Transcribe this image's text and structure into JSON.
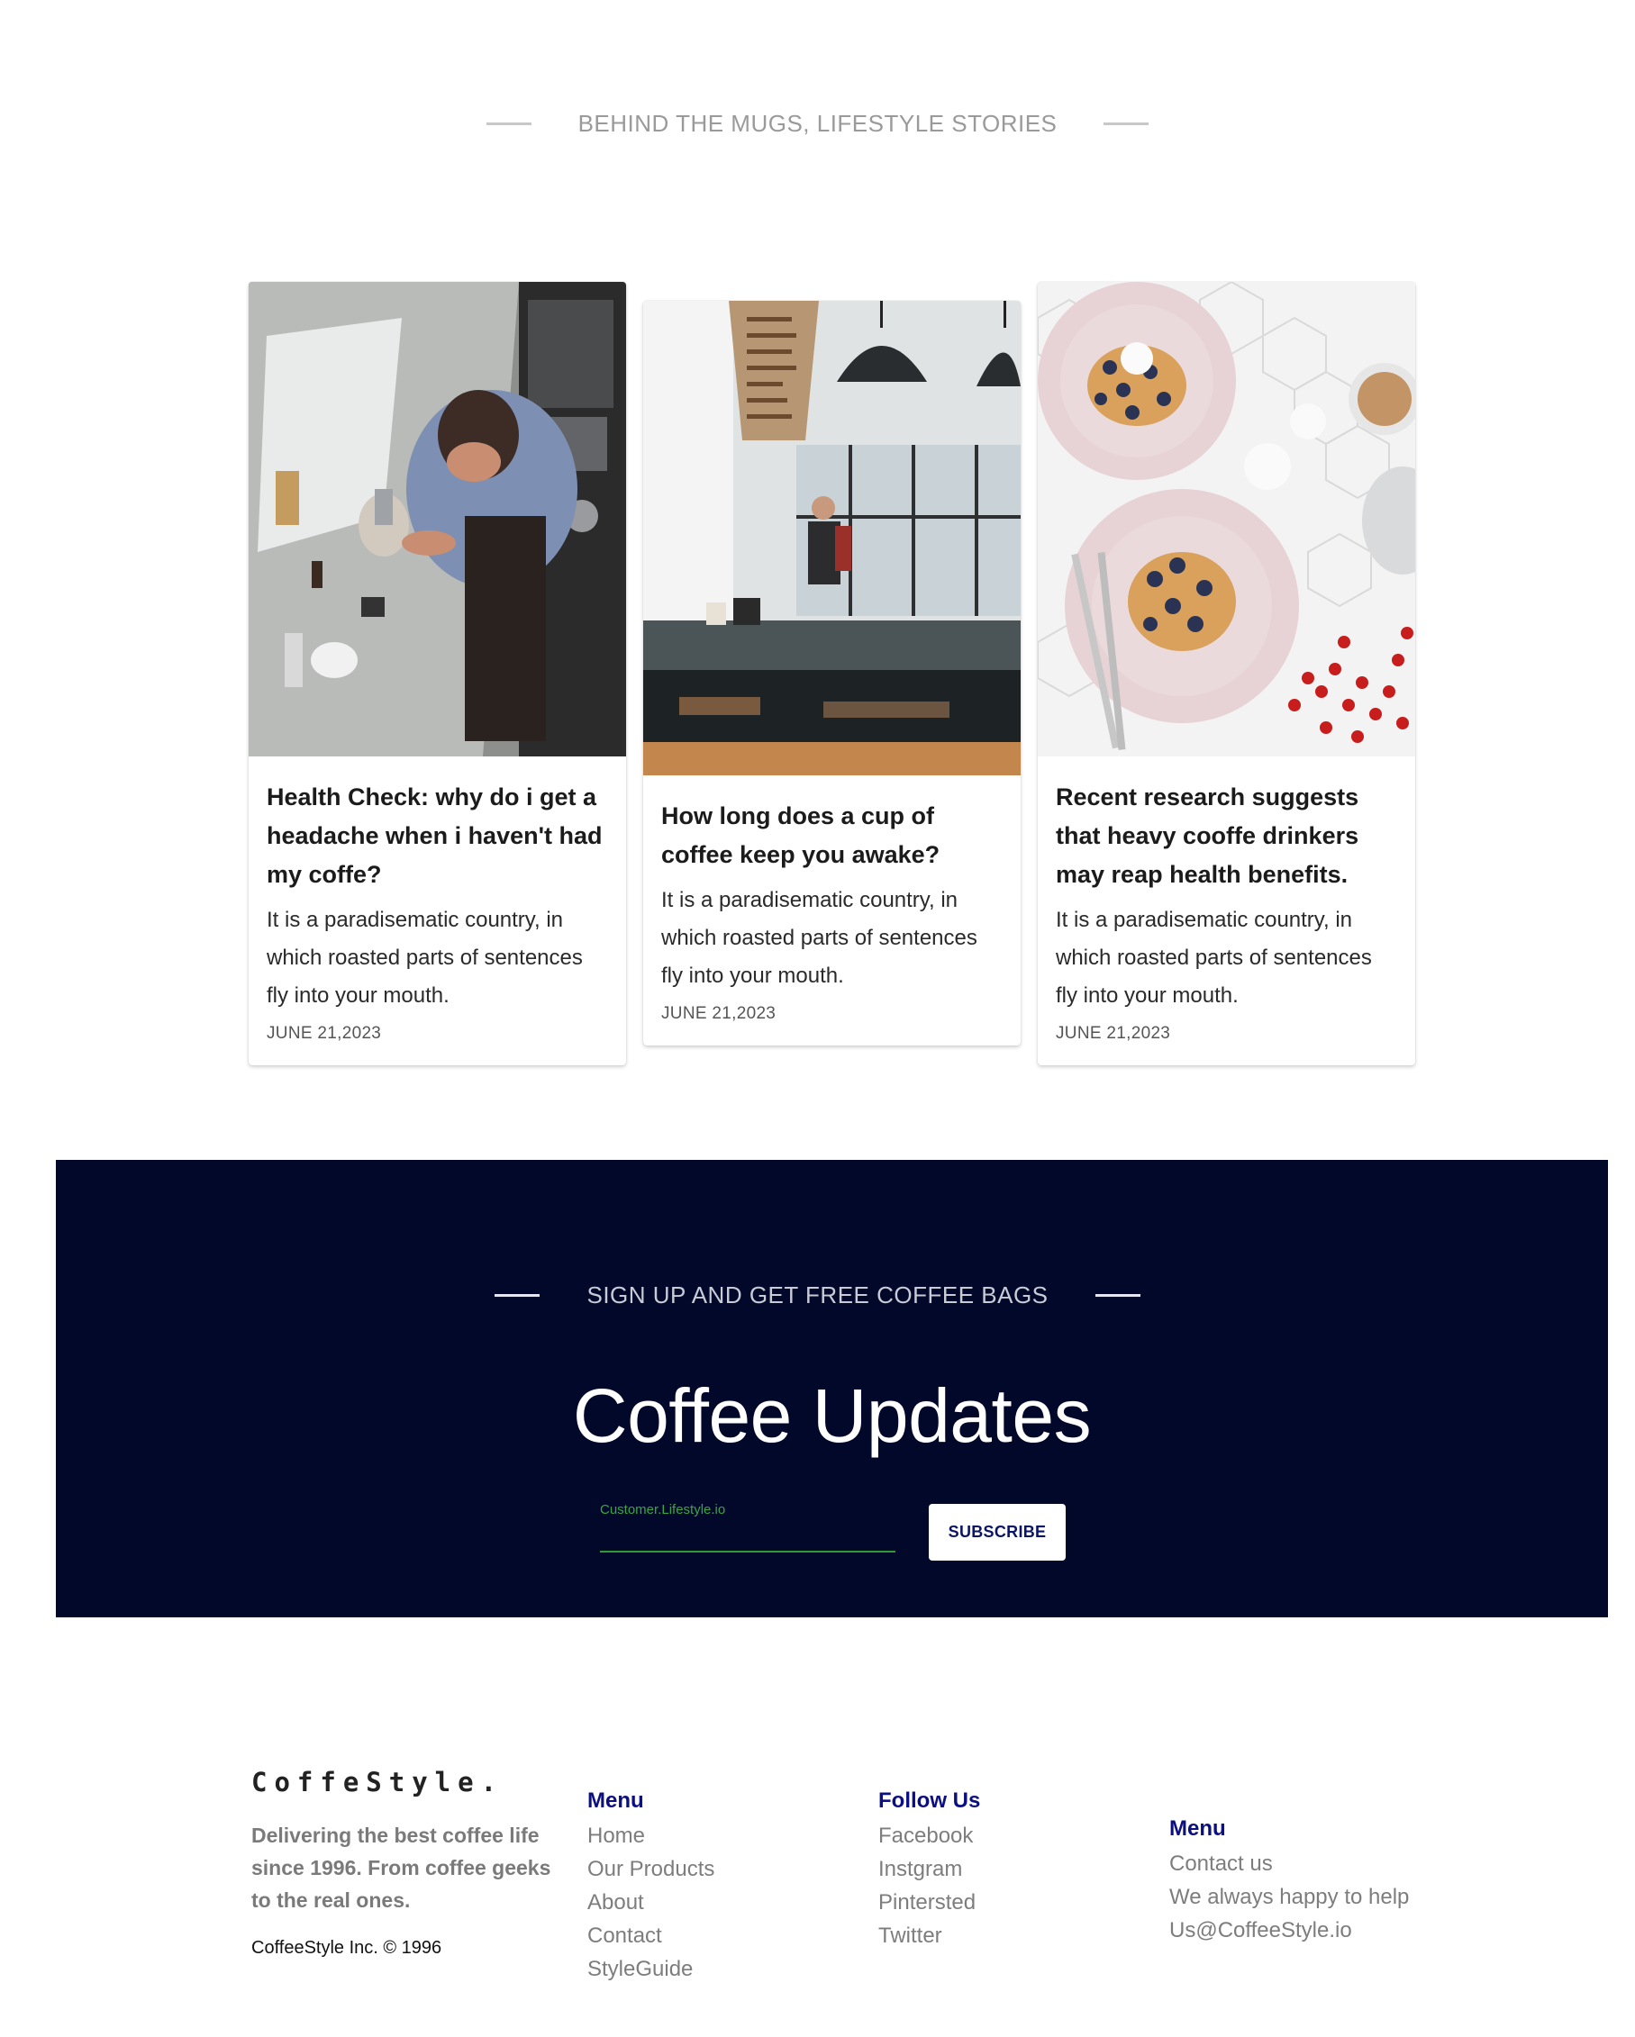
{
  "stories": {
    "eyebrow": "BEHIND THE MUGS, LIFESTYLE STORIES",
    "cards": [
      {
        "title": "Health Check: why do i get a headache when i haven't had my coffe?",
        "excerpt": "It is a paradisematic country, in which roasted parts of sentences fly into your mouth.",
        "date": "JUNE 21,2023",
        "image": "barista-pouring-milk-photo"
      },
      {
        "title": "How long does a cup of coffee keep you awake?",
        "excerpt": "It is a paradisematic country, in which roasted parts of sentences fly into your mouth.",
        "date": "JUNE 21,2023",
        "image": "coffee-shop-counter-photo"
      },
      {
        "title": "Recent research suggests that heavy cooffe drinkers may reap health benefits.",
        "excerpt": "It is a paradisematic country, in which roasted parts of sentences fly into your mouth.",
        "date": "JUNE 21,2023",
        "image": "waffles-berries-plates-photo"
      }
    ]
  },
  "newsletter": {
    "eyebrow": "SIGN UP AND GET FREE COFFEE BAGS",
    "title": "Coffee Updates",
    "email_label": "Customer.Lifestyle.io",
    "email_value": "",
    "subscribe_label": "SUBSCRIBE",
    "colors": {
      "background": "#01082a",
      "accent": "#2e9a3a"
    }
  },
  "footer": {
    "brand": "CoffeStyle.",
    "tagline": "Delivering the best coffee life since 1996. From coffee geeks to the real ones.",
    "copyright": "CoffeeStyle Inc. © 1996",
    "menu": {
      "heading": "Menu",
      "links": [
        "Home",
        "Our Products",
        "About",
        "Contact",
        "StyleGuide"
      ]
    },
    "follow": {
      "heading": "Follow Us",
      "links": [
        "Facebook",
        "Instgram",
        "Pintersted",
        "Twitter"
      ]
    },
    "contact": {
      "heading": "Menu",
      "items": [
        "Contact us",
        "We always happy to help",
        "Us@CoffeeStyle.io"
      ]
    },
    "colors": {
      "heading": "#0b0f80"
    }
  }
}
